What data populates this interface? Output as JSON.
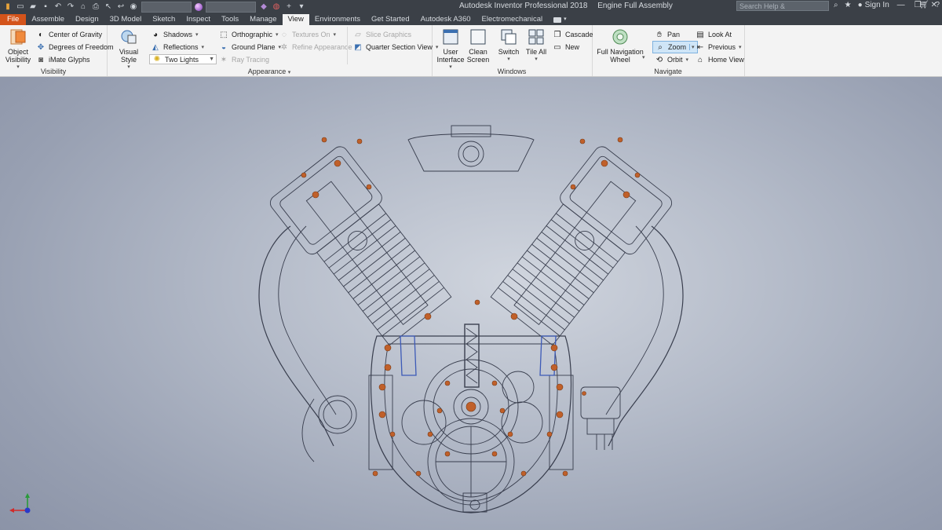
{
  "window": {
    "app_title": "Autodesk Inventor Professional 2018",
    "document_title": "Engine Full Assembly",
    "search_placeholder": "Search Help & Commands...",
    "sign_in": "Sign In"
  },
  "tabs": [
    {
      "label": "File"
    },
    {
      "label": "Assemble"
    },
    {
      "label": "Design"
    },
    {
      "label": "3D Model"
    },
    {
      "label": "Sketch"
    },
    {
      "label": "Inspect"
    },
    {
      "label": "Tools"
    },
    {
      "label": "Manage"
    },
    {
      "label": "View"
    },
    {
      "label": "Environments"
    },
    {
      "label": "Get Started"
    },
    {
      "label": "Autodesk A360"
    },
    {
      "label": "Electromechanical"
    }
  ],
  "ribbon": {
    "visibility": {
      "title": "Visibility",
      "object_visibility": "Object Visibility",
      "center_of_gravity": "Center of Gravity",
      "degrees_of_freedom": "Degrees of Freedom",
      "imate_glyphs": "iMate Glyphs"
    },
    "appearance": {
      "title": "Appearance",
      "visual_style": "Visual Style",
      "shadows": "Shadows",
      "reflections": "Reflections",
      "lighting_value": "Two Lights",
      "orthographic": "Orthographic",
      "ground_plane": "Ground Plane",
      "ray_tracing": "Ray Tracing",
      "textures_on": "Textures On",
      "refine_appearance": "Refine Appearance",
      "slice_graphics": "Slice Graphics",
      "quarter_section_view": "Quarter Section View"
    },
    "windows": {
      "title": "Windows",
      "user_interface": "User Interface",
      "clean_screen": "Clean Screen",
      "switch": "Switch",
      "tile_all": "Tile All",
      "cascade": "Cascade",
      "new": "New"
    },
    "navigate": {
      "title": "Navigate",
      "full_navigation_wheel": "Full Navigation Wheel",
      "pan": "Pan",
      "zoom": "Zoom",
      "orbit": "Orbit",
      "look_at": "Look At",
      "previous": "Previous",
      "home_view": "Home View"
    }
  },
  "colors": {
    "title_bg": "#3b4047",
    "file_tab": "#d4541b",
    "ribbon_bg": "#f3f3f3",
    "wire": "#2b3040",
    "fastener": "#c0602a"
  }
}
